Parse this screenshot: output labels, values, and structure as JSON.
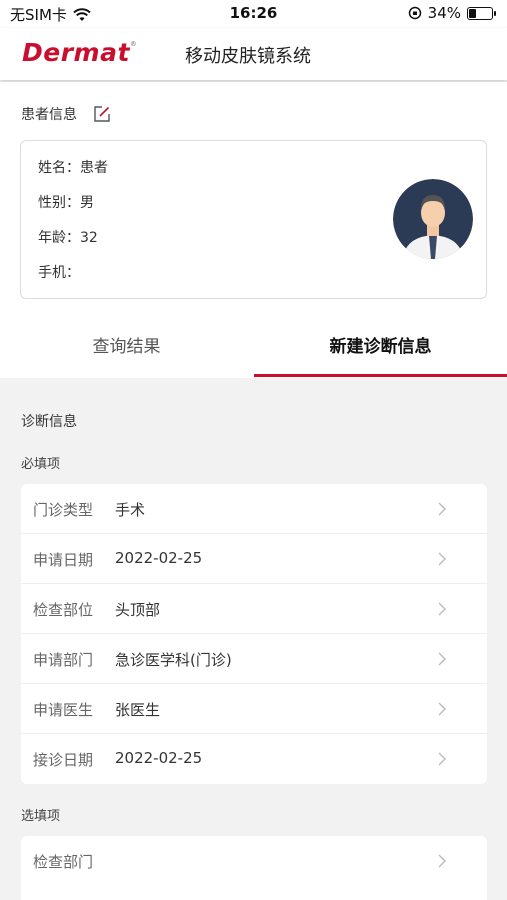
{
  "status_bar": {
    "carrier": "无SIM卡",
    "time": "16:26",
    "battery_pct": "34%",
    "battery_level": 0.34
  },
  "header": {
    "logo": "Dermat",
    "title": "移动皮肤镜系统"
  },
  "patient": {
    "section_title": "患者信息",
    "fields": [
      {
        "label": "姓名：",
        "value": "患者"
      },
      {
        "label": "性别：",
        "value": "男"
      },
      {
        "label": "年龄：",
        "value": "32"
      },
      {
        "label": "手机：",
        "value": ""
      }
    ]
  },
  "tabs": [
    {
      "label": "查询结果",
      "active": false
    },
    {
      "label": "新建诊断信息",
      "active": true
    }
  ],
  "diagnosis": {
    "title": "诊断信息",
    "required_label": "必填项",
    "required_rows": [
      {
        "label": "门诊类型",
        "value": "手术"
      },
      {
        "label": "申请日期",
        "value": "2022-02-25"
      },
      {
        "label": "检查部位",
        "value": "头顶部"
      },
      {
        "label": "申请部门",
        "value": "急诊医学科(门诊)"
      },
      {
        "label": "申请医生",
        "value": "张医生"
      },
      {
        "label": "接诊日期",
        "value": "2022-02-25"
      }
    ],
    "optional_label": "选填项",
    "optional_rows": [
      {
        "label": "检查部门",
        "value": ""
      }
    ]
  }
}
